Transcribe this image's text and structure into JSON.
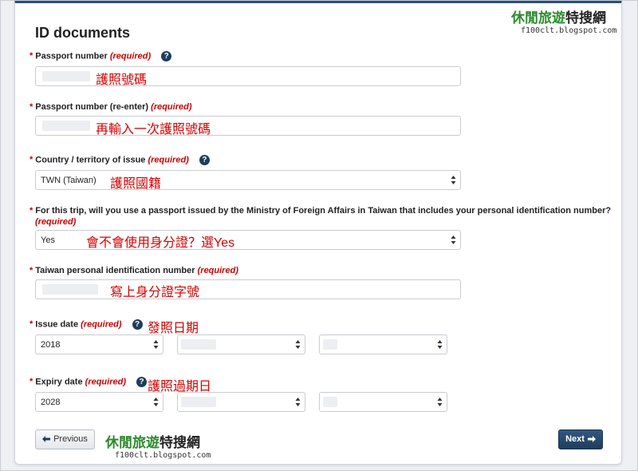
{
  "section_title": "ID documents",
  "common": {
    "required_tag": "(required)",
    "help_glyph": "?"
  },
  "fields": {
    "passport_number": {
      "label": "Passport number",
      "annotation": "護照號碼"
    },
    "passport_reenter": {
      "label": "Passport number (re-enter)",
      "annotation": "再輸入一次護照號碼"
    },
    "country": {
      "label": "Country / territory of issue",
      "value": "TWN (Taiwan)",
      "annotation": "護照國籍"
    },
    "mofa_question": {
      "label": "For this trip, will you use a passport issued by the Ministry of Foreign Affairs in Taiwan that includes your personal identification number?",
      "value": "Yes",
      "annotation": "會不會使用身分證？選Yes"
    },
    "taiwan_id": {
      "label": "Taiwan personal identification number",
      "annotation": "寫上身分證字號"
    },
    "issue_date": {
      "label": "Issue date",
      "year": "2018",
      "annotation": "發照日期"
    },
    "expiry_date": {
      "label": "Expiry date",
      "year": "2028",
      "annotation": "護照過期日"
    }
  },
  "buttons": {
    "previous": "Previous",
    "next": "Next"
  },
  "watermark": {
    "title_green": "休閒旅遊",
    "title_dark": "特搜網",
    "url": "f100clt.blogspot.com"
  },
  "colors": {
    "accent": "#1f3d5c",
    "required": "#cc0000",
    "annotation": "#d60000",
    "brand_green": "#2d8a2d"
  }
}
